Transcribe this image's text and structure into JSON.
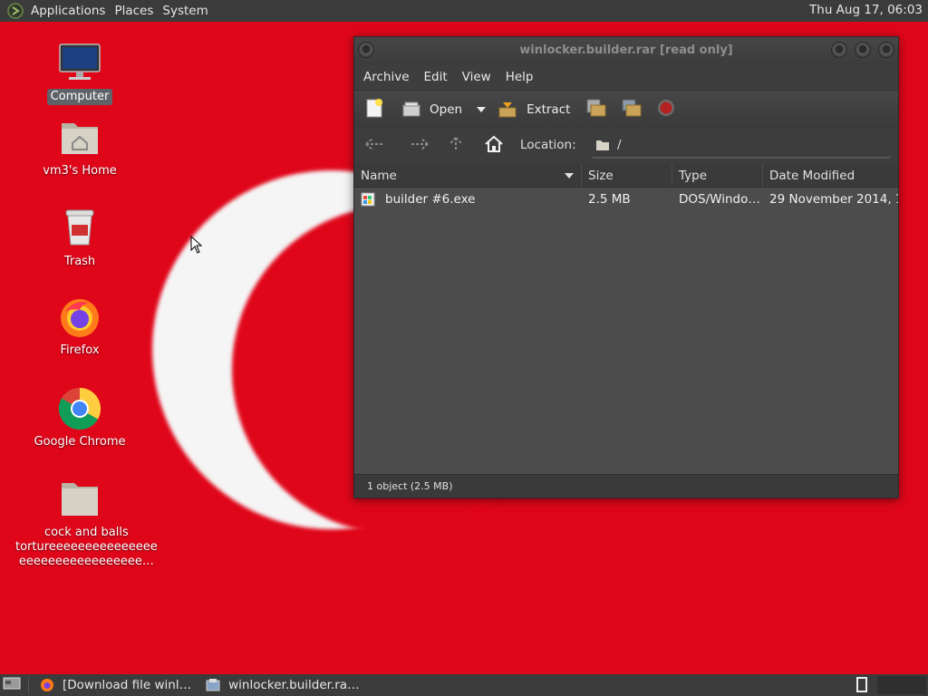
{
  "top_panel": {
    "menus": [
      "Applications",
      "Places",
      "System"
    ],
    "clock": "Thu Aug 17, 06:03"
  },
  "desktop": {
    "icons": [
      {
        "label": "Computer",
        "icon": "computer-icon"
      },
      {
        "label": "vm3's Home",
        "icon": "home-folder-icon"
      },
      {
        "label": "Trash",
        "icon": "trash-icon"
      },
      {
        "label": "Firefox",
        "icon": "firefox-icon"
      },
      {
        "label": "Google Chrome",
        "icon": "chrome-icon"
      },
      {
        "label_line1": "cock and balls",
        "label_line2": "tortureeeeeeeeeeeeeee",
        "label_line3": "eeeeeeeeeeeeeeeee…",
        "icon": "folder-icon"
      }
    ]
  },
  "window": {
    "title": "winlocker.builder.rar [read only]",
    "menubar": [
      "Archive",
      "Edit",
      "View",
      "Help"
    ],
    "toolbar": {
      "open_label": "Open",
      "extract_label": "Extract"
    },
    "navbar": {
      "location_label": "Location:",
      "location_value": "/"
    },
    "columns": [
      "Name",
      "Size",
      "Type",
      "Date Modified"
    ],
    "files": [
      {
        "name": "builder #6.exe",
        "size": "2.5 MB",
        "type": "DOS/Windo…",
        "modified": "29 November 2014, 1…"
      }
    ],
    "status": "1 object (2.5 MB)"
  },
  "taskbar": {
    "tasks": [
      {
        "label": "[Download file winl…",
        "icon": "firefox-icon"
      },
      {
        "label": "winlocker.builder.ra…",
        "icon": "archive-manager-icon"
      }
    ]
  },
  "colors": {
    "desktop_bg": "#e0061a",
    "panel_bg": "#3b3b3b",
    "window_bg": "#4c4c4c"
  }
}
